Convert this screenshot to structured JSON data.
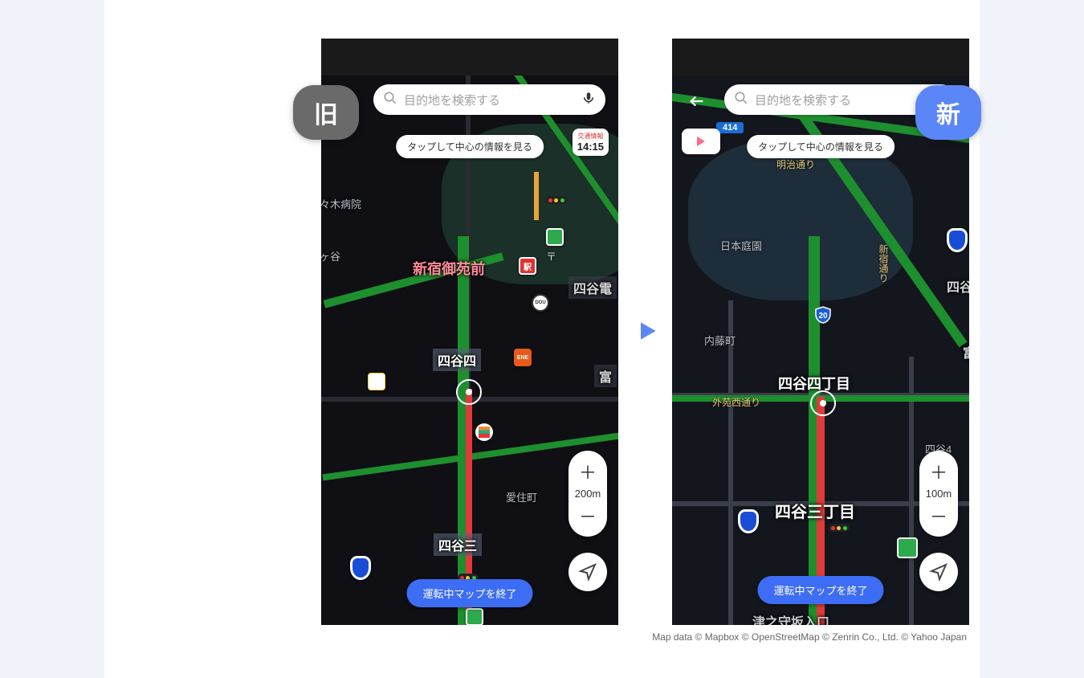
{
  "tags": {
    "old": "旧",
    "new": "新"
  },
  "search": {
    "placeholder": "目的地を検索する"
  },
  "hint": "タップして中心の情報を見る",
  "traffic_badge": {
    "label": "交通情報",
    "time": "14:15"
  },
  "route_num": "414",
  "end_btn": "運転中マップを終了",
  "zoom": {
    "left_scale": "200m",
    "right_scale": "100m",
    "plus": "＋",
    "minus": "－"
  },
  "labels_left": {
    "hospital": "々木病院",
    "kagaya": "ヶ谷",
    "shinjuku_gyoen": "新宿御苑前",
    "yotsuya4": "四谷四",
    "yotsuya_den": "四谷電",
    "yotsuya3": "四谷三",
    "aizumi": "愛住町",
    "tomi": "富",
    "te": "〒"
  },
  "labels_right": {
    "garden": "日本庭園",
    "naito": "内藤町",
    "yotsuya4chome": "四谷四丁目",
    "yotsuya3chome": "四谷三丁目",
    "yotsuya4": "四谷4",
    "yotsu": "四谷",
    "tomi": "富",
    "tsunokami": "津之守坂入口",
    "shinjuku_st": "新宿通り",
    "gaien_st": "外苑西通り",
    "meiji_st": "明治通り",
    "route20": "20"
  },
  "poi_names": {
    "familymart": "FamilyMart",
    "seveneleven": "7-Eleven",
    "eneos": "ENEOS",
    "doutor": "DOUTOR",
    "ministop": "MINISTOP",
    "lawson": "LAWSON",
    "station": "駅"
  },
  "copyright": "Map data © Mapbox © OpenStreetMap © Zenrin Co., Ltd.    © Yahoo Japan"
}
